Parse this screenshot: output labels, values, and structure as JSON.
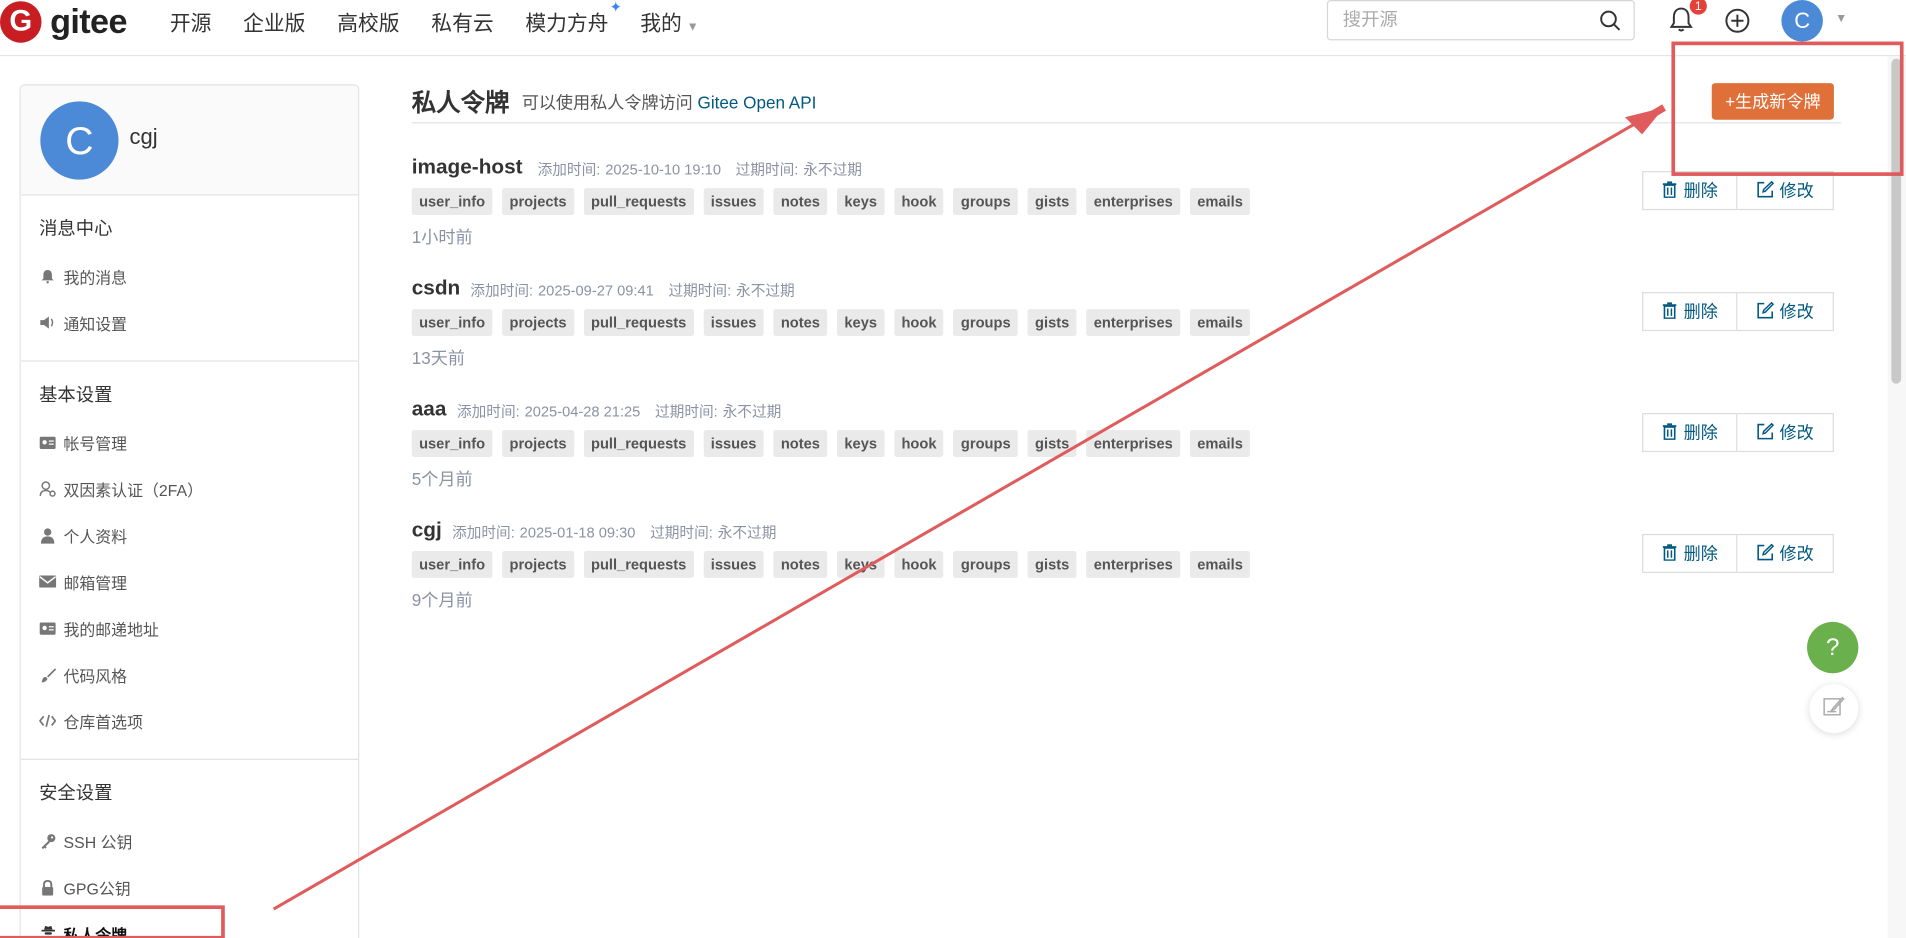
{
  "topbar": {
    "logo_glyph": "G",
    "logo_text": "gitee",
    "nav": [
      "开源",
      "企业版",
      "高校版",
      "私有云",
      "模力方舟",
      "我的"
    ],
    "search_placeholder": "搜开源",
    "notification_count": "1",
    "avatar_letter": "C"
  },
  "sidebar": {
    "avatar_letter": "C",
    "username": "cgj",
    "sections": [
      {
        "title": "消息中心",
        "items": [
          {
            "label": "我的消息",
            "icon": "bell-icon"
          },
          {
            "label": "通知设置",
            "icon": "speaker-icon"
          }
        ]
      },
      {
        "title": "基本设置",
        "items": [
          {
            "label": "帐号管理",
            "icon": "id-card-icon"
          },
          {
            "label": "双因素认证（2FA）",
            "icon": "user-shield-icon"
          },
          {
            "label": "个人资料",
            "icon": "user-icon"
          },
          {
            "label": "邮箱管理",
            "icon": "envelope-icon"
          },
          {
            "label": "我的邮递地址",
            "icon": "address-card-icon"
          },
          {
            "label": "代码风格",
            "icon": "brush-icon"
          },
          {
            "label": "仓库首选项",
            "icon": "code-icon"
          }
        ]
      },
      {
        "title": "安全设置",
        "items": [
          {
            "label": "SSH 公钥",
            "icon": "key-icon"
          },
          {
            "label": "GPG公钥",
            "icon": "lock-icon"
          },
          {
            "label": "私人令牌",
            "icon": "user-secret-icon"
          }
        ]
      }
    ]
  },
  "main": {
    "title": "私人令牌",
    "subtitle_prefix": "可以使用私人令牌访问",
    "subtitle_link": "Gitee Open API",
    "generate_button": "+生成新令牌",
    "delete_label": "删除",
    "edit_label": "修改",
    "added_prefix": "添加时间:",
    "expire_prefix": "过期时间:",
    "tokens": [
      {
        "name": "image-host",
        "added": "2025-10-10 19:10",
        "expire": "永不过期",
        "ago": "1小时前",
        "scopes": [
          "user_info",
          "projects",
          "pull_requests",
          "issues",
          "notes",
          "keys",
          "hook",
          "groups",
          "gists",
          "enterprises",
          "emails"
        ]
      },
      {
        "name": "csdn",
        "added": "2025-09-27 09:41",
        "expire": "永不过期",
        "ago": "13天前",
        "scopes": [
          "user_info",
          "projects",
          "pull_requests",
          "issues",
          "notes",
          "keys",
          "hook",
          "groups",
          "gists",
          "enterprises",
          "emails"
        ]
      },
      {
        "name": "aaa",
        "added": "2025-04-28 21:25",
        "expire": "永不过期",
        "ago": "5个月前",
        "scopes": [
          "user_info",
          "projects",
          "pull_requests",
          "issues",
          "notes",
          "keys",
          "hook",
          "groups",
          "gists",
          "enterprises",
          "emails"
        ]
      },
      {
        "name": "cgj",
        "added": "2025-01-18 09:30",
        "expire": "永不过期",
        "ago": "9个月前",
        "scopes": [
          "user_info",
          "projects",
          "pull_requests",
          "issues",
          "notes",
          "keys",
          "hook",
          "groups",
          "gists",
          "enterprises",
          "emails"
        ]
      }
    ]
  },
  "floating": {
    "help_label": "?"
  },
  "colors": {
    "brand_red": "#c71d23",
    "generate_orange": "#e0703a",
    "link_blue": "#005980",
    "annotation_red": "#e05b5b",
    "help_green": "#6ab04c"
  }
}
